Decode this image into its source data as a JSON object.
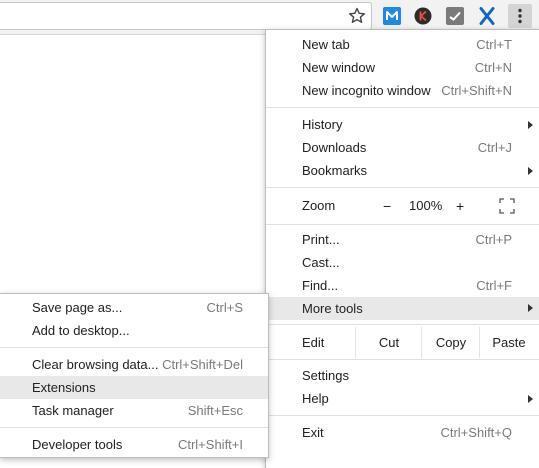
{
  "toolbar": {
    "icons": [
      "star-icon",
      "m-extension-icon",
      "k-extension-icon",
      "check-extension-icon",
      "x-extension-icon",
      "kebab-menu-icon"
    ],
    "colors": {
      "m_ext": "#1e88e5",
      "k_ext": "#2b2b2b",
      "k_letter": "#e0533d",
      "check_ext": "#7b7b7b",
      "x_ext": "#1565c0"
    }
  },
  "main_menu": {
    "new_tab": {
      "label": "New tab",
      "shortcut": "Ctrl+T"
    },
    "new_window": {
      "label": "New window",
      "shortcut": "Ctrl+N"
    },
    "new_incognito": {
      "label": "New incognito window",
      "shortcut": "Ctrl+Shift+N"
    },
    "history": {
      "label": "History"
    },
    "downloads": {
      "label": "Downloads",
      "shortcut": "Ctrl+J"
    },
    "bookmarks": {
      "label": "Bookmarks"
    },
    "zoom": {
      "label": "Zoom",
      "minus": "−",
      "value": "100%",
      "plus": "+"
    },
    "print": {
      "label": "Print...",
      "shortcut": "Ctrl+P"
    },
    "cast": {
      "label": "Cast..."
    },
    "find": {
      "label": "Find...",
      "shortcut": "Ctrl+F"
    },
    "more_tools": {
      "label": "More tools"
    },
    "edit": {
      "label": "Edit",
      "cut": "Cut",
      "copy": "Copy",
      "paste": "Paste"
    },
    "settings": {
      "label": "Settings"
    },
    "help": {
      "label": "Help"
    },
    "exit": {
      "label": "Exit",
      "shortcut": "Ctrl+Shift+Q"
    }
  },
  "sub_menu": {
    "save_page": {
      "label": "Save page as...",
      "shortcut": "Ctrl+S"
    },
    "add_desktop": {
      "label": "Add to desktop..."
    },
    "clear_data": {
      "label": "Clear browsing data...",
      "shortcut": "Ctrl+Shift+Del"
    },
    "extensions": {
      "label": "Extensions"
    },
    "task_manager": {
      "label": "Task manager",
      "shortcut": "Shift+Esc"
    },
    "dev_tools": {
      "label": "Developer tools",
      "shortcut": "Ctrl+Shift+I"
    }
  }
}
